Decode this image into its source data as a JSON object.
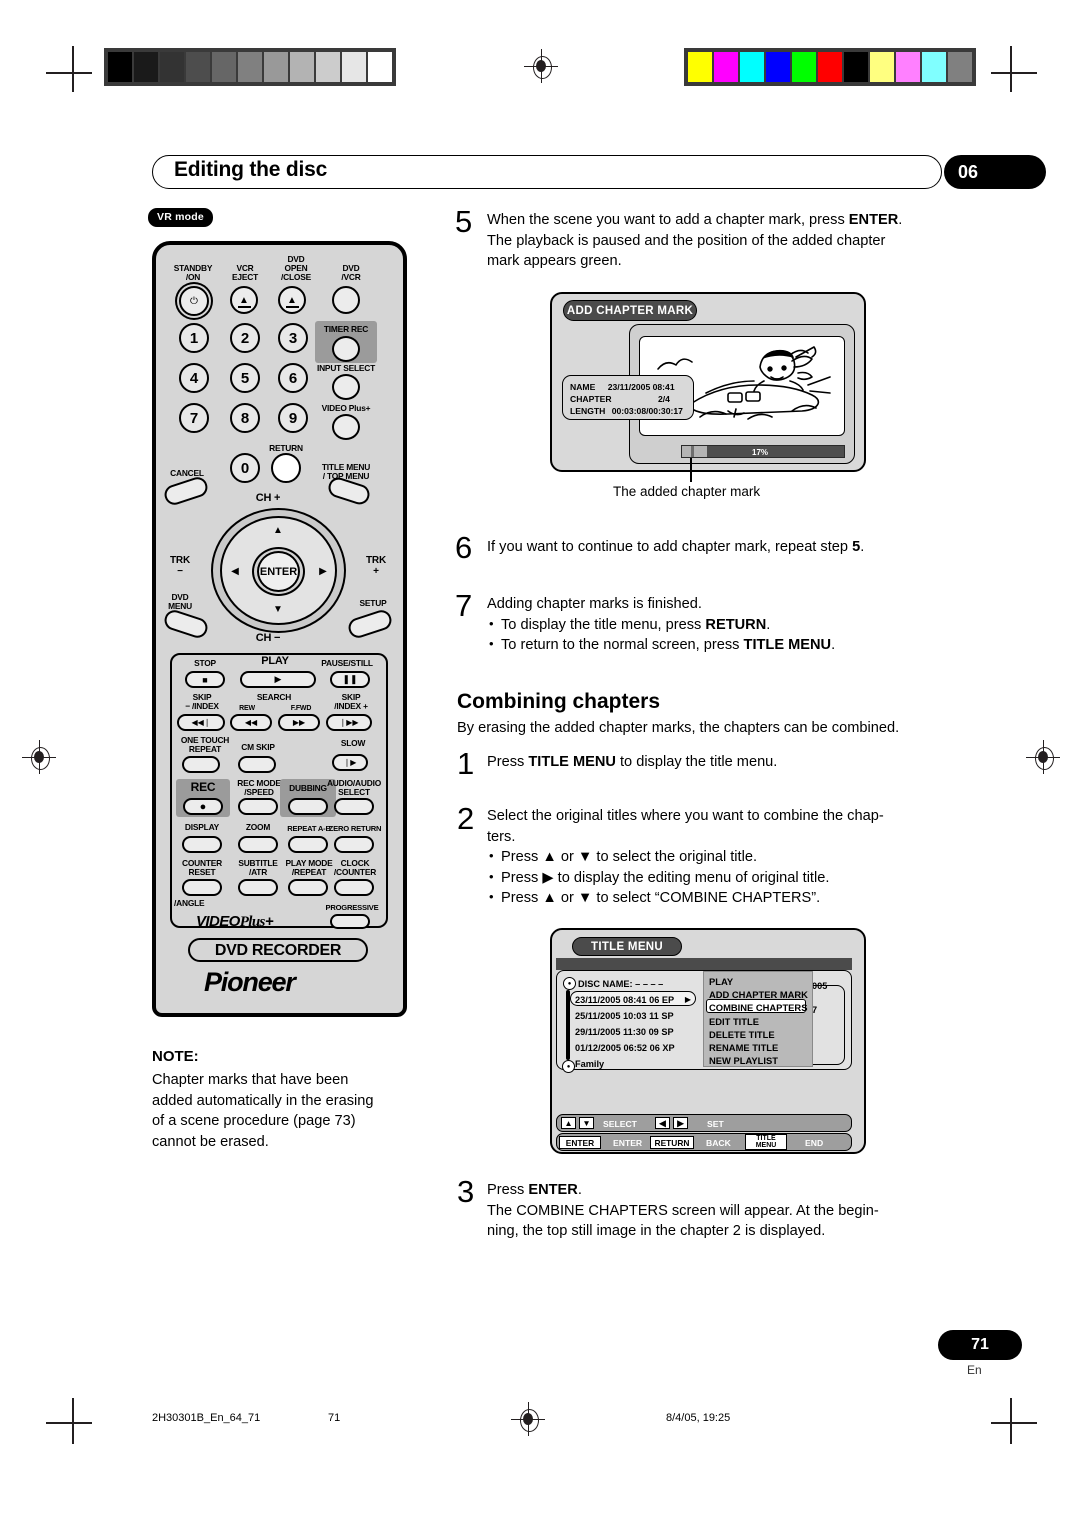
{
  "page": {
    "header_title": "Editing the disc",
    "chapter_badge": "06",
    "mode_badge": "VR mode",
    "page_number": "71",
    "page_lang": "En"
  },
  "remote": {
    "top_labels": [
      "STANDBY\n/ON",
      "VCR\nEJECT",
      "DVD\nOPEN\n/CLOSE",
      "DVD\n/VCR"
    ],
    "standby_label_l1": "STANDBY",
    "standby_label_l2": "/ON",
    "vcr_eject_l1": "VCR",
    "vcr_eject_l2": "EJECT",
    "dvd_open_l1": "DVD",
    "dvd_open_l2": "OPEN",
    "dvd_open_l3": "/CLOSE",
    "dvd_vcr_l1": "DVD",
    "dvd_vcr_l2": "/VCR",
    "timer_rec": "TIMER REC",
    "input_select": "INPUT SELECT",
    "video_plus": "VIDEO Plus+",
    "return": "RETURN",
    "cancel": "CANCEL",
    "title_menu_l1": "TITLE MENU",
    "title_menu_l2": "/ TOP MENU",
    "numbers": [
      "1",
      "2",
      "3",
      "4",
      "5",
      "6",
      "7",
      "8",
      "9",
      "0"
    ],
    "ch_plus": "CH +",
    "ch_minus": "CH −",
    "trk_minus_l1": "TRK",
    "trk_minus_l2": "−",
    "trk_plus_l1": "TRK",
    "trk_plus_l2": "+",
    "enter": "ENTER",
    "dvd_menu_l1": "DVD",
    "dvd_menu_l2": "MENU",
    "setup": "SETUP",
    "stop": "STOP",
    "play": "PLAY",
    "pause_still": "PAUSE/STILL",
    "skip_index_minus_l1": "SKIP",
    "skip_index_minus_l2": "− /INDEX",
    "search": "SEARCH",
    "rew": "REW",
    "ffwd": "F.FWD",
    "skip_index_plus_l1": "SKIP",
    "skip_index_plus_l2": "/INDEX +",
    "one_touch_l1": "ONE TOUCH",
    "one_touch_l2": "REPEAT",
    "cm_skip": "CM SKIP",
    "slow": "SLOW",
    "rec": "REC",
    "rec_mode_l1": "REC MODE",
    "rec_mode_l2": "/SPEED",
    "dubbing": "DUBBING",
    "audio_l1": "AUDIO/AUDIO",
    "audio_l2": "SELECT",
    "display": "DISPLAY",
    "zoom": "ZOOM",
    "repeat_ab": "REPEAT A-B",
    "zero_return": "ZERO RETURN",
    "counter_l1": "COUNTER",
    "counter_l2": "RESET",
    "subtitle_l1": "SUBTITLE",
    "subtitle_l2": "/ATR",
    "playmode_l1": "PLAY MODE",
    "playmode_l2": "/REPEAT",
    "clock_l1": "CLOCK",
    "clock_l2": "/COUNTER",
    "angle": "/ANGLE",
    "progressive": "PROGRESSIVE",
    "videoplus_logo_1": "VIDEO",
    "videoplus_logo_2": "Plus",
    "videoplus_logo_3": "+",
    "dvd_recorder": "DVD RECORDER",
    "brand": "Pioneer"
  },
  "steps": {
    "s5_num": "5",
    "s5_l1_a": "When the scene you want to add a chapter mark, press ",
    "s5_l1_b": "ENTER",
    "s5_l1_c": ".",
    "s5_l2": "The playback is paused and the position of the added chapter",
    "s5_l3": "mark appears green.",
    "s6_num": "6",
    "s6_a": "If you want to continue to add chapter mark, repeat step ",
    "s6_b": "5",
    "s6_c": ".",
    "s7_num": "7",
    "s7_l1": "Adding chapter marks is finished.",
    "s7_b1_a": "To display the title menu, press ",
    "s7_b1_b": "RETURN",
    "s7_b1_c": ".",
    "s7_b2_a": "To return to the normal screen, press ",
    "s7_b2_b": "TITLE MENU",
    "s7_b2_c": ".",
    "c1_num": "1",
    "c1_a": "Press ",
    "c1_b": "TITLE MENU",
    "c1_c": " to display the title menu.",
    "c2_num": "2",
    "c2_l1": "Select the original titles where you want to combine the chap-",
    "c2_l2": "ters.",
    "c2_b1": "Press ▲ or ▼ to select the original title.",
    "c2_b2": "Press ▶ to display the editing menu of original title.",
    "c2_b3": "Press ▲ or ▼ to select “COMBINE CHAPTERS”.",
    "c3_num": "3",
    "c3_l1_a": "Press ",
    "c3_l1_b": "ENTER",
    "c3_l1_c": ".",
    "c3_l2": "The COMBINE CHAPTERS screen will appear. At the begin-",
    "c3_l3": "ning, the top still image in the chapter 2 is displayed."
  },
  "section": {
    "heading": "Combining chapters",
    "intro": "By erasing the added chapter marks, the chapters can be combined."
  },
  "osd_add_chapter": {
    "title": "ADD CHAPTER MARK",
    "rows": [
      {
        "label": "NAME",
        "value": "23/11/2005 08:41"
      },
      {
        "label": "CHAPTER",
        "value": "2/4"
      },
      {
        "label": "LENGTH",
        "value": "00:03:08/00:30:17"
      }
    ],
    "progress_pct_label": "17%",
    "progress_pct": 17,
    "caption": "The added chapter mark"
  },
  "osd_title_menu": {
    "title": "TITLE MENU",
    "disc_name": "DISC NAME: – – – –",
    "titles": [
      "23/11/2005 08:41 06 EP",
      "25/11/2005 10:03 11 SP",
      "29/11/2005 11:30 09 SP",
      "01/12/2005 06:52 06 XP",
      "Family"
    ],
    "selected_title_index": 0,
    "menu_items": [
      "PLAY",
      "ADD CHAPTER MARK",
      "COMBINE CHAPTERS",
      "EDIT TITLE",
      "DELETE TITLE",
      "RENAME TITLE",
      "NEW PLAYLIST"
    ],
    "selected_menu_index": 2,
    "ghost_right_1": "005",
    "ghost_right_2": "7",
    "guide": [
      {
        "keys": [
          "▲",
          "▼"
        ],
        "label": "SELECT"
      },
      {
        "keys": [
          "◀",
          "▶"
        ],
        "label": "SET"
      },
      {
        "keys": [
          "ENTER"
        ],
        "label": "ENTER"
      },
      {
        "keys": [
          "RETURN"
        ],
        "label": "BACK"
      },
      {
        "keys": [
          "TITLE\nMENU"
        ],
        "label": "END"
      }
    ],
    "guide_key_enter": "ENTER",
    "guide_lbl_enter": "ENTER",
    "guide_key_return": "RETURN",
    "guide_lbl_back": "BACK",
    "guide_key_title_1": "TITLE",
    "guide_key_title_2": "MENU",
    "guide_lbl_end": "END",
    "guide_lbl_select": "SELECT",
    "guide_lbl_set": "SET"
  },
  "note": {
    "heading": "NOTE:",
    "l1": "Chapter marks that have been",
    "l2": "added automatically in the erasing",
    "l3": "of a scene procedure (page 73)",
    "l4": "cannot be erased."
  },
  "printer_marks": {
    "footer_file": "2H30301B_En_64_71",
    "footer_page": "71",
    "footer_date": "8/4/05, 19:25",
    "gray_bars": [
      "#000000",
      "#1a1a1a",
      "#333333",
      "#4d4d4d",
      "#666666",
      "#808080",
      "#999999",
      "#b3b3b3",
      "#cccccc",
      "#e6e6e6",
      "#ffffff"
    ],
    "color_bars": [
      "#ffff00",
      "#ff00ff",
      "#00ffff",
      "#0000ff",
      "#00ff00",
      "#ff0000",
      "#000000",
      "#ffff80",
      "#ff80ff",
      "#80ffff",
      "#808080"
    ]
  }
}
